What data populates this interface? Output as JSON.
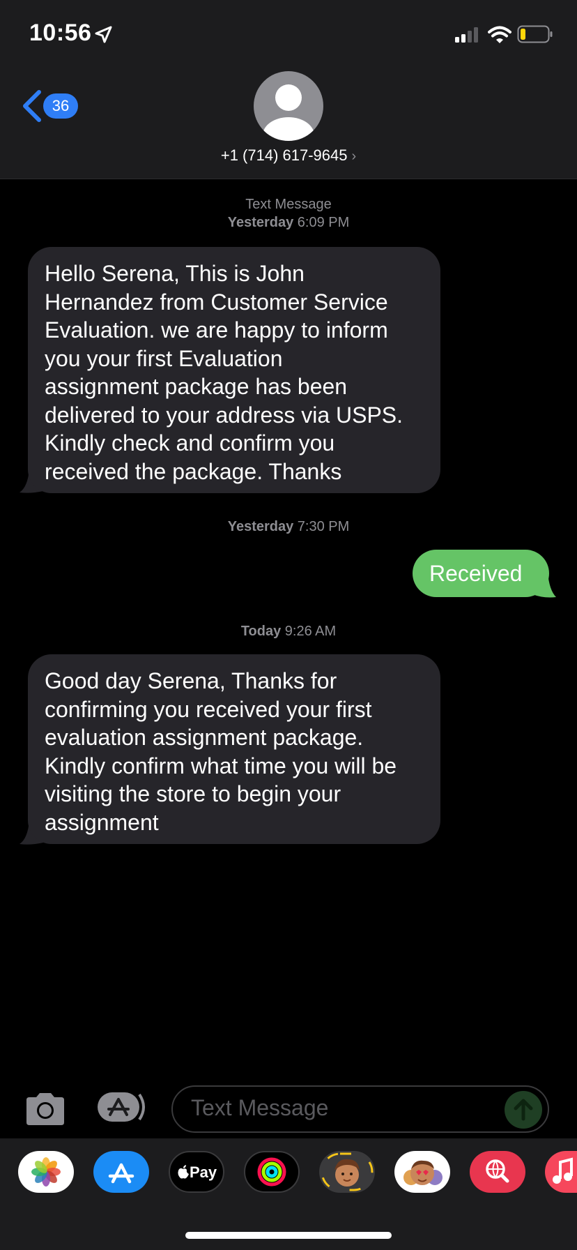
{
  "status_bar": {
    "time": "10:56",
    "icons": [
      "location-arrow-icon",
      "signal-icon",
      "wifi-icon",
      "battery-icon"
    ]
  },
  "header": {
    "back_badge": "36",
    "contact": "+1 (714) 617-9645",
    "chevron": "›"
  },
  "thread": {
    "stamp1_title": "Text Message",
    "stamp1_day": "Yesterday",
    "stamp1_time": "6:09 PM",
    "message1_lines": [
      "Hello Serena, This is John",
      "Hernandez from Customer Service",
      "Evaluation. we are happy to inform",
      "you your first Evaluation",
      "assignment package has been",
      "delivered to your address via USPS.",
      "Kindly check and confirm you",
      "received the package. Thanks"
    ],
    "stamp2_day": "Yesterday",
    "stamp2_time": "7:30 PM",
    "reply": "Received",
    "stamp3_day": "Today",
    "stamp3_time": "9:26 AM",
    "message2_lines": [
      "Good day Serena, Thanks for",
      "confirming you received your first",
      "evaluation assignment package.",
      "Kindly confirm what time you will be",
      "visiting the store to begin your",
      "assignment"
    ]
  },
  "composer": {
    "placeholder": "Text Message"
  },
  "app_drawer": {
    "apps": [
      "photos-app-icon",
      "app-store-icon",
      "apple-pay-icon",
      "activity-icon",
      "memoji-icon",
      "memoji-stickers-icon",
      "web-search-icon",
      "music-icon"
    ],
    "apple_pay_label": "Pay"
  },
  "colors": {
    "incoming": "#26252a",
    "outgoing": "#65c466",
    "badge": "#2f7ef6",
    "background": "#000000",
    "header": "#1c1c1e"
  }
}
